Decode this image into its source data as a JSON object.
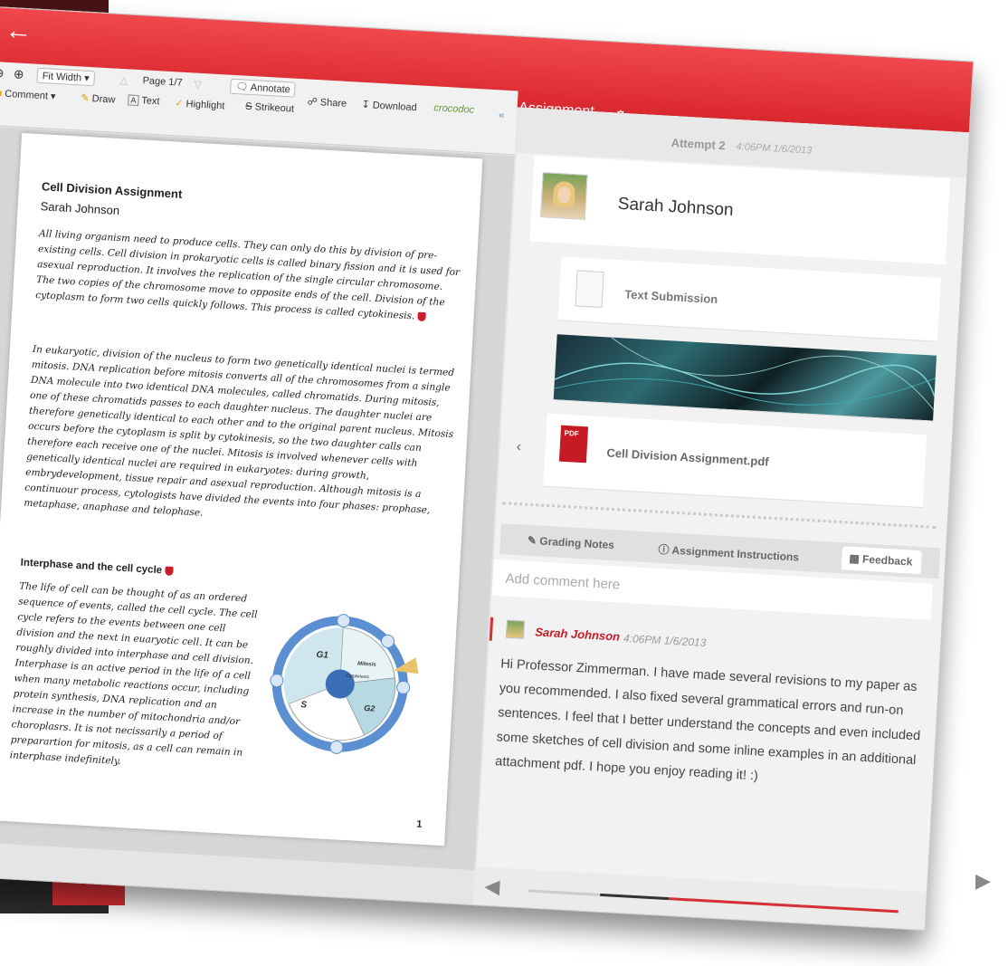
{
  "header": {
    "title": "Cell Division Assignment",
    "back_icon": "back-arrow-icon",
    "settings_icon": "gear-icon"
  },
  "toolbar": {
    "zoom_out_icon": "zoom-out-icon",
    "zoom_in_icon": "zoom-in-icon",
    "fit_width": "Fit Width",
    "page_indicator": "Page 1/7",
    "annotate": "Annotate",
    "comment": "Comment",
    "draw": "Draw",
    "text": "Text",
    "highlight": "Highlight",
    "strikeout": "Strikeout",
    "share": "Share",
    "download": "Download",
    "brand": "crocodoc"
  },
  "document": {
    "title": "Cell Division Assignment",
    "author": "Sarah Johnson",
    "paragraph1": "All living organism need to produce cells. They can only do this by division of pre-existing cells. Cell division in prokaryotic cells is called binary fission and it is used for asexual reproduction. It involves the replication of the single circular chromosome. The two copies of the chromosome move to opposite ends of the cell. Division of the cytoplasm to form two cells quickly follows. This process is called cytokinesis.",
    "paragraph2": "In eukaryotic, division of the nucleus to form two genetically identical nuclei is termed mitosis. DNA replication before mitosis converts all of the chromosomes from a single DNA molecule into two identical DNA molecules, called chromatids. During mitosis, one of these chromatids passes to each daughter nucleus. The daughter nuclei are therefore genetically identical to each other and to the original parent nucleus. Mitosis occurs before the cytoplasm is split by cytokinesis, so the two daughter calls can therefore each receive one of the nuclei. Mitosis is involved whenever cells with genetically identical nuclei are required in eukaryotes: during growth, embrydevelopment, tissue repair and asexual reproduction. Although mitosis is a continuour process, cytologists have divided the events into four phases: prophase, metaphase, anaphase and telophase.",
    "section_heading": "Interphase and the cell cycle",
    "paragraph3": "The life of cell can be thought of as an ordered sequence of events, called the cell cycle. The cell cycle refers to the events between one cell division and the next in euaryotic cell. It can be roughly divided into interphase and cell division. Interphase is an active period in the life of a cell when many metabolic reactions occur, including protein synthesis, DNA replication and an increase in the number of mitochondria and/or choroplasrs. It is not necissarily a period of preparartion for mitosis, as a cell can remain in interphase indefinitely.",
    "page_number": "1",
    "diagram_labels": {
      "g1": "G1",
      "s": "S",
      "g2": "G2",
      "mitosis": "Mitosis",
      "cytokinesis": "Cytokinesis"
    }
  },
  "attempt": {
    "label": "Attempt 2",
    "time": "4:06PM 1/6/2013"
  },
  "student": {
    "name": "Sarah Johnson"
  },
  "submissions": {
    "text_label": "Text Submission",
    "pdf_label": "Cell Division Assignment.pdf",
    "pdf_badge": "PDF"
  },
  "tabs": {
    "grading_notes": "Grading Notes",
    "assignment_instructions": "Assignment Instructions",
    "feedback": "Feedback"
  },
  "comment_input": {
    "placeholder": "Add comment here"
  },
  "comment": {
    "author": "Sarah Johnson",
    "time": "4:06PM 1/6/2013",
    "body": "Hi Professor Zimmerman. I have made several revisions to my paper as you recommended. I also fixed several grammatical errors and run-on sentences. I feel that I better understand the concepts and even included some sketches of cell division and some inline examples in an additional attachment pdf. I hope you enjoy reading it! :)"
  },
  "colors": {
    "accent": "#d62f35",
    "author": "#c61b24"
  }
}
